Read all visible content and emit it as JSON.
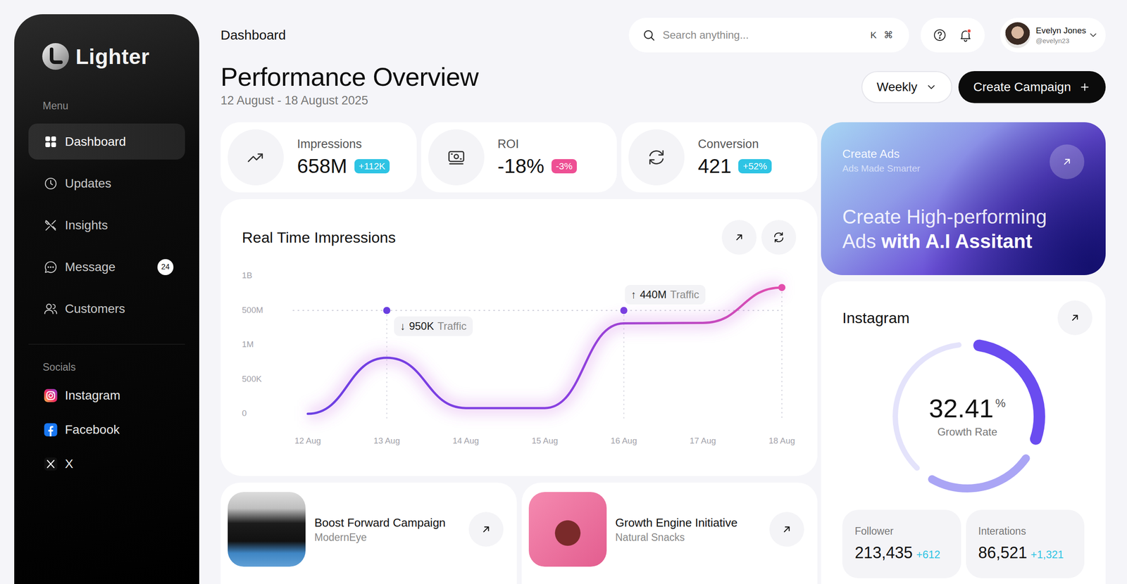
{
  "header": {
    "breadcrumb": "Dashboard",
    "search": {
      "placeholder": "Search anything...",
      "shortcut": [
        "K",
        "⌘"
      ]
    },
    "notifications": {
      "unread": true
    },
    "user": {
      "name": "Evelyn Jones",
      "handle": "@evelyn23"
    }
  },
  "page": {
    "title": "Performance Overview",
    "date_range": "12 August - 18 August 2025",
    "period": "Weekly",
    "primary_action": "Create Campaign"
  },
  "sidebar": {
    "brand": "Lighter",
    "menu_label": "Menu",
    "items": [
      {
        "label": "Dashboard",
        "selected": true
      },
      {
        "label": "Updates",
        "selected": false
      },
      {
        "label": "Insights",
        "selected": false
      },
      {
        "label": "Message",
        "selected": false,
        "badge": "24"
      },
      {
        "label": "Customers",
        "selected": false
      }
    ],
    "socials_label": "Socials",
    "socials": [
      {
        "label": "Instagram"
      },
      {
        "label": "Facebook"
      },
      {
        "label": "X"
      }
    ]
  },
  "stats": [
    {
      "label": "Impressions",
      "value": "658M",
      "change": "+112K",
      "color": "#2ec4e4"
    },
    {
      "label": "ROI",
      "value": "-18%",
      "change": "-3%",
      "color": "#ee4f94"
    },
    {
      "label": "Conversion",
      "value": "421",
      "change": "+52%",
      "color": "#2ec4e4"
    }
  ],
  "chart": {
    "title": "Real Time Impressions",
    "y_ticks": [
      {
        "label": "1B",
        "value": 1000000000
      },
      {
        "label": "500M",
        "value": 500000000
      },
      {
        "label": "1M",
        "value": 1000000
      },
      {
        "label": "500K",
        "value": 500000
      },
      {
        "label": "0",
        "value": 0
      }
    ],
    "x_labels": [
      "12 Aug",
      "13 Aug",
      "14 Aug",
      "15 Aug",
      "16 Aug",
      "17 Aug",
      "18 Aug"
    ],
    "series": [
      {
        "name": "Impressions",
        "values": [
          0,
          812500,
          83000,
          83000,
          313000000,
          320000000,
          833000000
        ]
      }
    ],
    "guide_value": 500000000,
    "markers": [
      {
        "x_index": 1,
        "value": 500000000,
        "color": "#6a3fe0",
        "tooltip": {
          "icon": "↓",
          "value": "950K",
          "label": "Traffic",
          "placement": "below"
        }
      },
      {
        "x_index": 4,
        "value": 500000000,
        "color": "#7a3fe0",
        "tooltip": {
          "icon": "↑",
          "value": "440M",
          "label": "Traffic",
          "placement": "above"
        }
      },
      {
        "x_index": 6,
        "value": 833000000,
        "color": "#e34fad"
      }
    ]
  },
  "campaigns": [
    {
      "title": "Boost Forward Campaign",
      "brand": "ModernEye"
    },
    {
      "title": "Growth Engine Initiative",
      "brand": "Natural Snacks"
    }
  ],
  "ads_card": {
    "title": "Create Ads",
    "subtitle": "Ads Made Smarter",
    "headline": [
      [
        {
          "text": "Create High-performing",
          "bold": false
        }
      ],
      [
        {
          "text": "Ads",
          "bold": false
        },
        {
          "text": "with A.I Assitant",
          "bold": true
        }
      ]
    ]
  },
  "instagram": {
    "title": "Instagram",
    "growth": {
      "value": "32.41",
      "unit": "%",
      "label": "Growth Rate"
    },
    "segments": [
      {
        "kind": "value",
        "level": 0.3,
        "color": "#6a4cf0"
      },
      {
        "kind": "secondary",
        "level": 0.25,
        "color": "#aaa5f5"
      },
      {
        "kind": "track",
        "level": 0.37,
        "color": "#e4e3fb"
      }
    ],
    "stats": [
      {
        "label": "Follower",
        "value": "213,435",
        "change": "+612"
      },
      {
        "label": "Interations",
        "value": "86,521",
        "change": "+1,321"
      }
    ]
  }
}
